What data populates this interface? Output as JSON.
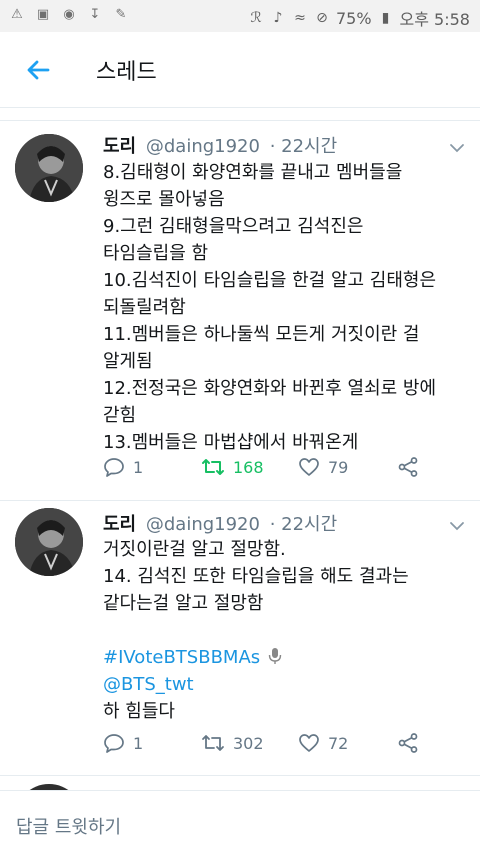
{
  "status_bar": {
    "battery": "75%",
    "time": "오후 5:58"
  },
  "header": {
    "title": "스레드"
  },
  "tweets": [
    {
      "name": "도리",
      "handle": "@daing1920",
      "time": "· 22시간",
      "lines": [
        "8.김태형이 화양연화를 끝내고 멤버들을",
        "윙즈로 몰아넣음",
        "9.그런 김태형을막으려고 김석진은",
        "타임슬립을 함",
        "10.김석진이 타임슬립을 한걸 알고 김태형은",
        "되돌릴려함",
        "11.멤버들은 하나둘씩 모든게 거짓이란 걸",
        "알게됨",
        "12.전정국은 화양연화와 바뀐후 열쇠로 방에",
        "갇힘",
        "13.멤버들은 마법샵에서 바꿔온게"
      ],
      "replies": "1",
      "retweets": "168",
      "likes": "79"
    },
    {
      "name": "도리",
      "handle": "@daing1920",
      "time": "· 22시간",
      "lines": [
        "거짓이란걸 알고 절망함.",
        "14. 김석진 또한 타임슬립을 해도 결과는",
        "같다는걸 알고 절망함"
      ],
      "hashtag": "#IVoteBTSBBMAs",
      "mention": "@BTS_twt",
      "last_line": "하 힘들다",
      "replies": "1",
      "retweets": "302",
      "likes": "72"
    }
  ],
  "reply_bar": {
    "placeholder": "답글 트윗하기"
  },
  "colors": {
    "accent": "#1da1f2",
    "link": "#1b95e0",
    "retweet_active": "#17bf63",
    "meta": "#657786"
  }
}
